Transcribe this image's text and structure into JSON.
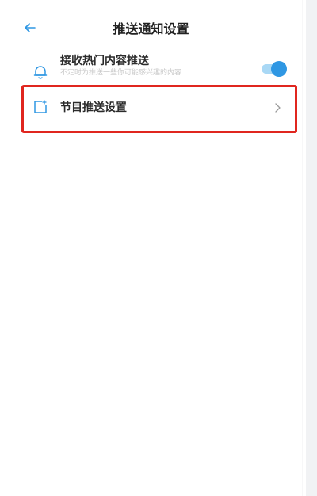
{
  "nav": {
    "title": "推送通知设置",
    "back_icon": "arrow-left-icon"
  },
  "settings": {
    "hot_push": {
      "title": "接收热门内容推送",
      "subtitle": "不定时为推送一些你可能感兴趣的内容",
      "icon": "bell-icon",
      "enabled": true
    },
    "program_push": {
      "label": "节目推送设置",
      "icon": "document-icon",
      "chevron": "chevron-right-icon"
    }
  },
  "colors": {
    "accent": "#2f97e3",
    "toggle_track": "#a9d8f5",
    "highlight_border": "#e0261f",
    "title_text": "#222222"
  }
}
